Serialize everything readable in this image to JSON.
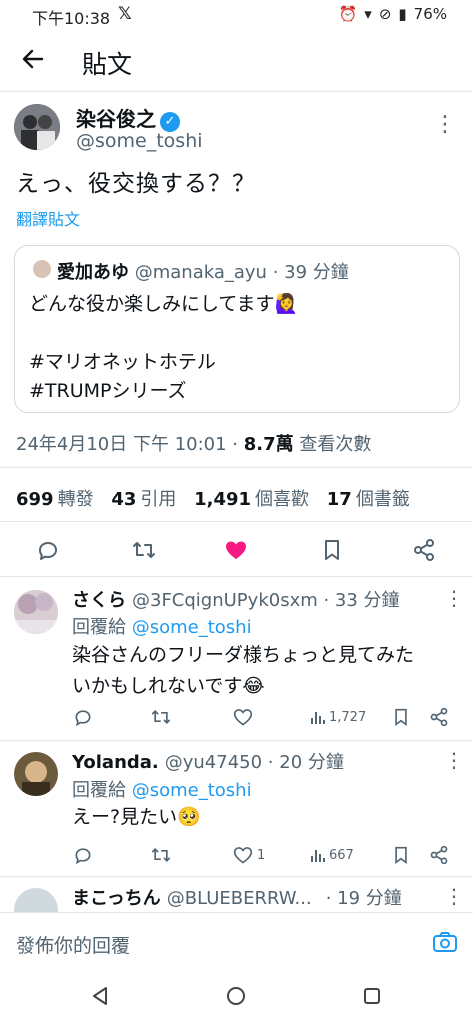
{
  "status_bar": {
    "time": "下午10:38",
    "battery": "76%"
  },
  "header": {
    "title": "貼文"
  },
  "tweet": {
    "author_name": "染谷俊之",
    "author_handle": "@some_toshi",
    "text": "えっ、役交換する？？",
    "translate_label": "翻譯貼文",
    "timestamp": "24年4月10日 下午 10:01 ·",
    "views_count": "8.7萬",
    "views_label": "查看次數",
    "stats": [
      {
        "count": "699",
        "label": "轉發"
      },
      {
        "count": "43",
        "label": "引用"
      },
      {
        "count": "1,491",
        "label": "個喜歡"
      },
      {
        "count": "17",
        "label": "個書籤"
      }
    ]
  },
  "quote": {
    "author_name": "愛加あゆ",
    "author_handle": "@manaka_ayu · 39 分鐘",
    "text": "どんな役か楽しみにしてます🙋‍♀️\n\n#マリオネットホテル\n#TRUMPシリーズ"
  },
  "replies": [
    {
      "name": "さくら",
      "handle": "@3FCqignUPyk0sxm · 33 分鐘",
      "reply_to_prefix": "回覆給",
      "reply_to": "@some_toshi",
      "text_line1": "染谷さんのフリーダ様ちょっと見てみた",
      "text_line2": "いかもしれないです😂",
      "likes": "",
      "views": "1,727"
    },
    {
      "name": "Yolanda.",
      "handle": "@yu47450 · 20 分鐘",
      "reply_to_prefix": "回覆給",
      "reply_to": "@some_toshi",
      "text_line1": "えー?見たい🥺",
      "text_line2": "",
      "likes": "1",
      "views": "667"
    },
    {
      "name": "まこっちん",
      "handle": "@BLUEBERRW...",
      "time": "· 19 分鐘"
    }
  ],
  "composer": {
    "placeholder": "發佈你的回覆"
  },
  "colors": {
    "accent": "#1d9bf0",
    "like": "#f91880",
    "text_secondary": "#536471"
  }
}
